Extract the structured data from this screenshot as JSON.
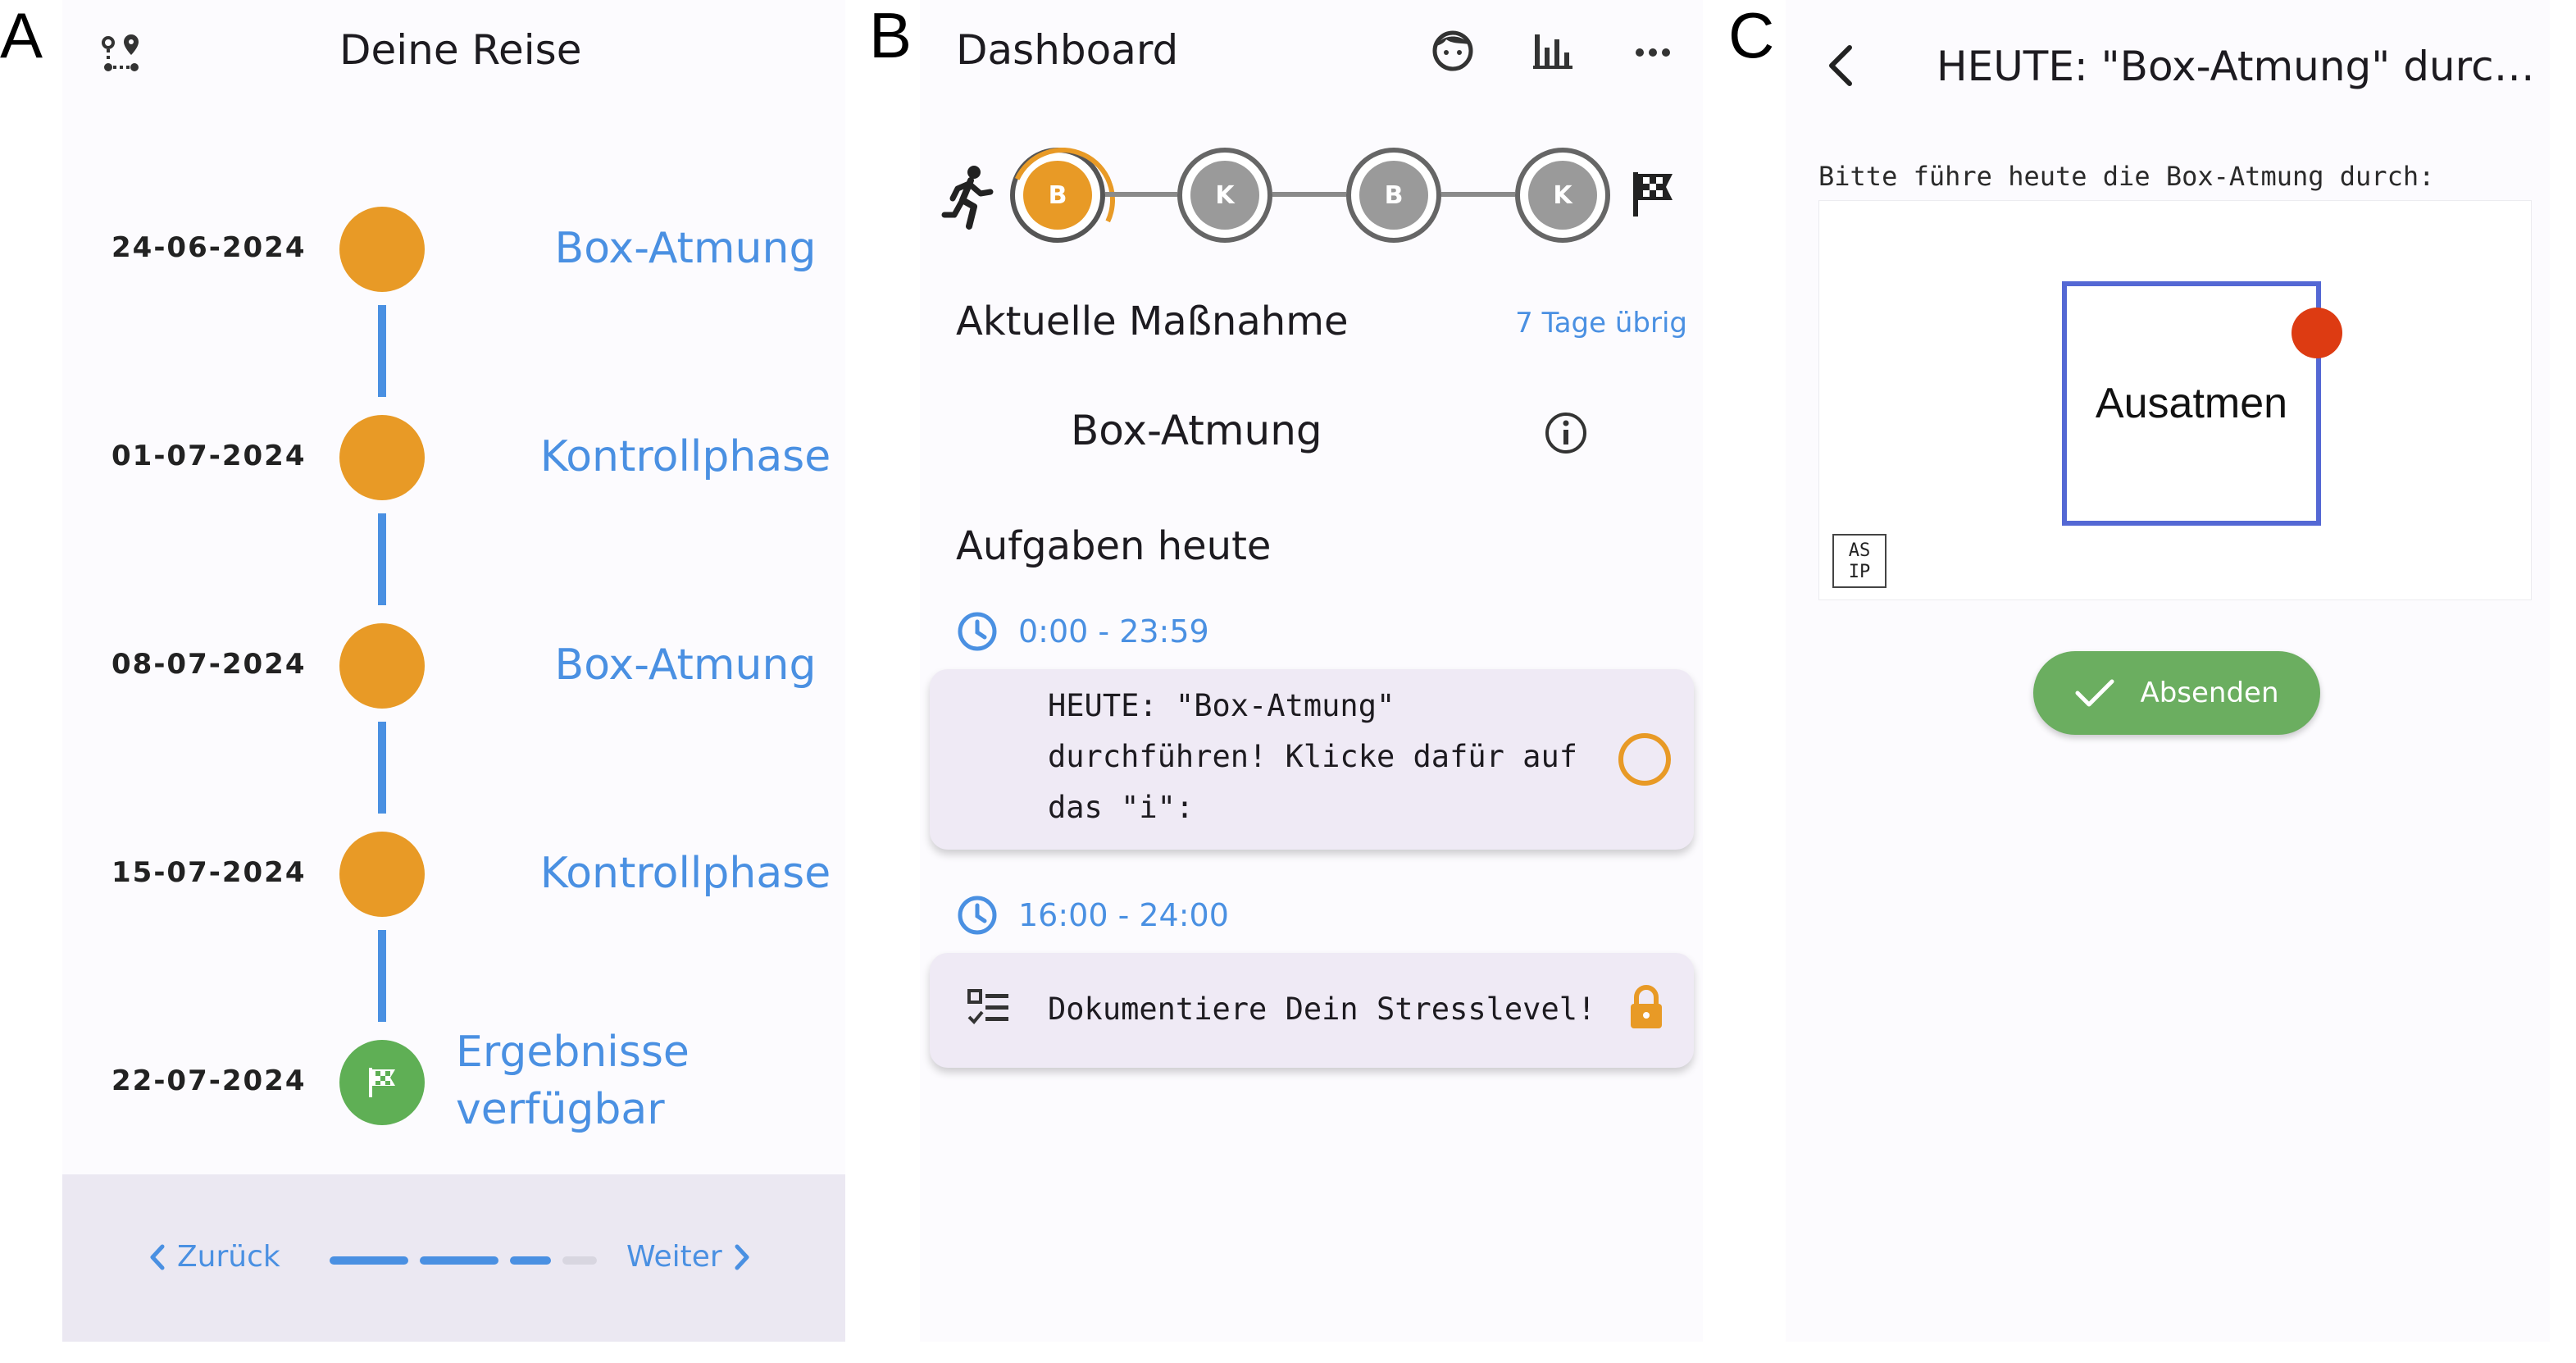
{
  "panel_labels": {
    "a": "A",
    "b": "B",
    "c": "C"
  },
  "colors": {
    "orange": "#e89a26",
    "blue": "#4a90e2",
    "green": "#5faf55",
    "submit_green": "#6bae60",
    "box_blue": "#5468d4",
    "dot_red": "#dd3b12",
    "card_bg": "#efeaf5"
  },
  "journey": {
    "title": "Deine Reise",
    "header_icon": "route-icon",
    "timeline": [
      {
        "date": "24-06-2024",
        "label": "Box-Atmung"
      },
      {
        "date": "01-07-2024",
        "label": "Kontrollphase"
      },
      {
        "date": "08-07-2024",
        "label": "Box-Atmung"
      },
      {
        "date": "15-07-2024",
        "label": "Kontrollphase"
      },
      {
        "date": "22-07-2024",
        "label": "Ergebnisse verfügbar",
        "label_line1": "Ergebnisse",
        "label_line2": "verfügbar",
        "icon": "finish-flag-icon"
      }
    ],
    "footer": {
      "back_label": "Zurück",
      "next_label": "Weiter",
      "steps_total": 4,
      "steps_completed": 3
    }
  },
  "dashboard": {
    "title": "Dashboard",
    "header_icons": [
      "face-icon",
      "bar-chart-icon",
      "more-horizontal-icon"
    ],
    "progress_nodes": [
      {
        "letter": "B",
        "state": "active"
      },
      {
        "letter": "K",
        "state": "upcoming"
      },
      {
        "letter": "B",
        "state": "upcoming"
      },
      {
        "letter": "K",
        "state": "upcoming"
      }
    ],
    "current_measure_heading": "Aktuelle Maßnahme",
    "days_remaining": "7 Tage übrig",
    "current_measure": "Box-Atmung",
    "tasks_heading": "Aufgaben heute",
    "tasks": [
      {
        "time": "0:00 - 23:59",
        "text_lines": [
          "HEUTE: \"Box-Atmung\"",
          "durchführen! Klicke dafür auf",
          "das \"i\":"
        ],
        "status_icon": "empty-circle-icon"
      },
      {
        "time": "16:00 - 24:00",
        "text_lines": [
          "Dokumentiere Dein Stresslevel!"
        ],
        "leading_icon": "checklist-icon",
        "status_icon": "lock-icon"
      }
    ]
  },
  "exercise": {
    "title": "HEUTE: \"Box-Atmung\" durch...",
    "instruction": "Bitte führe heute die Box-Atmung durch:",
    "box_label": "Ausatmen",
    "logo_line1": "AS",
    "logo_line2": "IP",
    "submit_label": "Absenden"
  }
}
